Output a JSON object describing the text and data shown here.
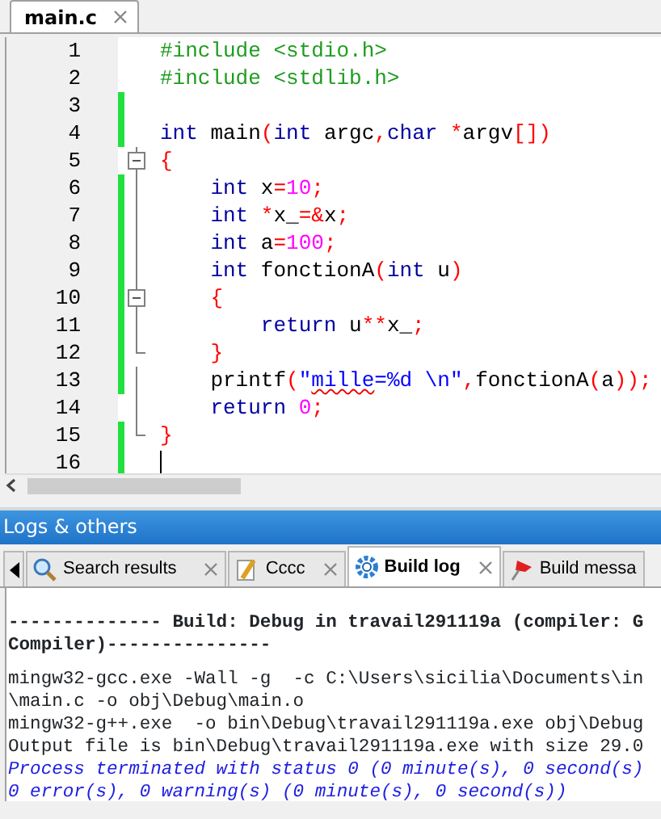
{
  "editor": {
    "tab": {
      "label": "main.c",
      "selected": true
    },
    "lines": [
      {
        "number": "1",
        "changed": false,
        "foldable": false,
        "fold_end": false,
        "tokens": [
          {
            "kind": "preproc",
            "text": "#include <stdio.h>"
          }
        ]
      },
      {
        "number": "2",
        "changed": false,
        "foldable": false,
        "fold_end": false,
        "tokens": [
          {
            "kind": "preproc",
            "text": "#include <stdlib.h>"
          }
        ]
      },
      {
        "number": "3",
        "changed": true,
        "foldable": false,
        "fold_end": false
      },
      {
        "number": "4",
        "changed": true,
        "foldable": false,
        "fold_end": false,
        "tokens": [
          {
            "kind": "keyword",
            "text": "int"
          },
          {
            "kind": "plain",
            "text": " main"
          },
          {
            "kind": "op",
            "text": "("
          },
          {
            "kind": "keyword",
            "text": "int"
          },
          {
            "kind": "plain",
            "text": " argc"
          },
          {
            "kind": "op",
            "text": ","
          },
          {
            "kind": "keyword",
            "text": "char"
          },
          {
            "kind": "op",
            "text": " *"
          },
          {
            "kind": "plain",
            "text": "argv"
          },
          {
            "kind": "op",
            "text": "[])"
          }
        ]
      },
      {
        "number": "5",
        "changed": false,
        "foldable": true,
        "fold_end": false,
        "tokens": [
          {
            "kind": "op",
            "text": "{"
          }
        ]
      },
      {
        "number": "6",
        "changed": true,
        "foldable": false,
        "fold_end": false,
        "tokens": [
          {
            "kind": "keyword",
            "text": "    int"
          },
          {
            "kind": "plain",
            "text": " x"
          },
          {
            "kind": "op",
            "text": "="
          },
          {
            "kind": "number",
            "text": "10"
          },
          {
            "kind": "op",
            "text": ";"
          }
        ]
      },
      {
        "number": "7",
        "changed": true,
        "foldable": false,
        "fold_end": false,
        "tokens": [
          {
            "kind": "keyword",
            "text": "    int"
          },
          {
            "kind": "op",
            "text": " *"
          },
          {
            "kind": "plain",
            "text": "x_"
          },
          {
            "kind": "op",
            "text": "=&"
          },
          {
            "kind": "plain",
            "text": "x"
          },
          {
            "kind": "op",
            "text": ";"
          }
        ]
      },
      {
        "number": "8",
        "changed": true,
        "foldable": false,
        "fold_end": false,
        "tokens": [
          {
            "kind": "keyword",
            "text": "    int"
          },
          {
            "kind": "plain",
            "text": " a"
          },
          {
            "kind": "op",
            "text": "="
          },
          {
            "kind": "number",
            "text": "100"
          },
          {
            "kind": "op",
            "text": ";"
          }
        ]
      },
      {
        "number": "9",
        "changed": true,
        "foldable": false,
        "fold_end": false,
        "tokens": [
          {
            "kind": "keyword",
            "text": "    int"
          },
          {
            "kind": "plain",
            "text": " fonctionA"
          },
          {
            "kind": "op",
            "text": "("
          },
          {
            "kind": "keyword",
            "text": "int"
          },
          {
            "kind": "plain",
            "text": " u"
          },
          {
            "kind": "op",
            "text": ")"
          }
        ]
      },
      {
        "number": "10",
        "changed": true,
        "foldable": true,
        "fold_end": false,
        "tokens": [
          {
            "kind": "op",
            "text": "    {"
          }
        ]
      },
      {
        "number": "11",
        "changed": true,
        "foldable": false,
        "fold_end": false,
        "tokens": [
          {
            "kind": "keyword",
            "text": "        return"
          },
          {
            "kind": "plain",
            "text": " u"
          },
          {
            "kind": "op",
            "text": "**"
          },
          {
            "kind": "plain",
            "text": "x_"
          },
          {
            "kind": "op",
            "text": ";"
          }
        ]
      },
      {
        "number": "12",
        "changed": true,
        "foldable": false,
        "fold_end": true,
        "tokens": [
          {
            "kind": "op",
            "text": "    }"
          }
        ]
      },
      {
        "number": "13",
        "changed": true,
        "foldable": false,
        "fold_end": false,
        "tokens": [
          {
            "kind": "plain",
            "text": "    printf"
          },
          {
            "kind": "op",
            "text": "("
          },
          {
            "kind": "string",
            "text": "\""
          },
          {
            "kind": "misspelled",
            "text": "mille"
          },
          {
            "kind": "string",
            "text": "=%d \\n\""
          },
          {
            "kind": "op",
            "text": ","
          },
          {
            "kind": "plain",
            "text": "fonctionA"
          },
          {
            "kind": "op",
            "text": "("
          },
          {
            "kind": "plain",
            "text": "a"
          },
          {
            "kind": "op",
            "text": "));"
          }
        ]
      },
      {
        "number": "14",
        "changed": false,
        "foldable": false,
        "fold_end": false,
        "tokens": [
          {
            "kind": "keyword",
            "text": "    return"
          },
          {
            "kind": "number",
            "text": " 0"
          },
          {
            "kind": "op",
            "text": ";"
          }
        ]
      },
      {
        "number": "15",
        "changed": true,
        "foldable": false,
        "fold_end": true,
        "tokens": [
          {
            "kind": "op",
            "text": "}"
          }
        ]
      },
      {
        "number": "16",
        "changed": true,
        "foldable": false,
        "fold_end": false
      }
    ]
  },
  "panel": {
    "title": "Logs & others",
    "tabs": [
      {
        "label": "Search results",
        "selected": false
      },
      {
        "label": "Cccc",
        "selected": false
      },
      {
        "label": "Build log",
        "selected": true
      },
      {
        "label": "Build messa",
        "selected": false
      }
    ],
    "log": [
      {
        "kind": "header",
        "text": "-------------- Build: Debug in travail291119a (compiler: G"
      },
      {
        "kind": "header",
        "text": "Compiler)---------------"
      },
      {
        "kind": "normal",
        "text": "mingw32-gcc.exe -Wall -g  -c C:\\Users\\sicilia\\Documents\\in"
      },
      {
        "kind": "normal",
        "text": "\\main.c -o obj\\Debug\\main.o"
      },
      {
        "kind": "normal",
        "text": "mingw32-g++.exe  -o bin\\Debug\\travail291119a.exe obj\\Debug"
      },
      {
        "kind": "normal",
        "text": "Output file is bin\\Debug\\travail291119a.exe with size 29.0"
      },
      {
        "kind": "status",
        "text": "Process terminated with status 0 (0 minute(s), 0 second(s)"
      },
      {
        "kind": "status",
        "text": "0 error(s), 0 warning(s) (0 minute(s), 0 second(s))"
      }
    ]
  }
}
